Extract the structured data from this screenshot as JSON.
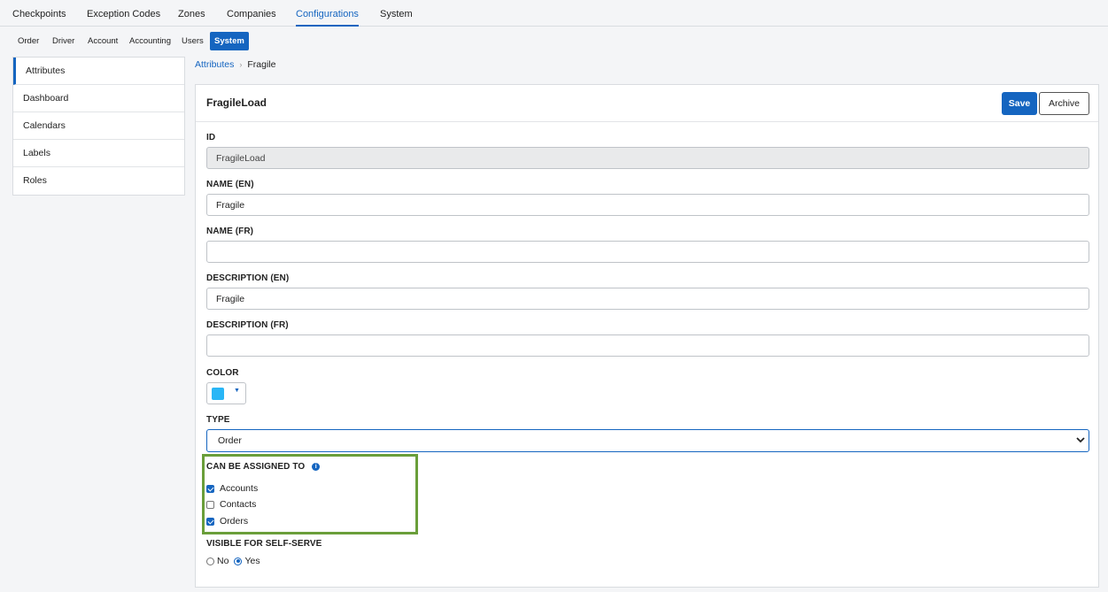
{
  "topnav": {
    "tabs": [
      {
        "label": "Checkpoints"
      },
      {
        "label": "Exception Codes"
      },
      {
        "label": "Zones"
      },
      {
        "label": "Companies"
      },
      {
        "label": "Configurations",
        "active": true
      },
      {
        "label": "System"
      }
    ]
  },
  "subnav": {
    "tabs": [
      {
        "label": "Order"
      },
      {
        "label": "Driver"
      },
      {
        "label": "Account"
      },
      {
        "label": "Accounting"
      },
      {
        "label": "Users"
      },
      {
        "label": "System",
        "active": true
      }
    ]
  },
  "sidebar": {
    "items": [
      {
        "label": "Attributes",
        "active": true
      },
      {
        "label": "Dashboard"
      },
      {
        "label": "Calendars"
      },
      {
        "label": "Labels"
      },
      {
        "label": "Roles"
      }
    ]
  },
  "breadcrumb": {
    "parent": "Attributes",
    "separator": "›",
    "current": "Fragile"
  },
  "panel": {
    "title": "FragileLoad",
    "save_label": "Save",
    "archive_label": "Archive"
  },
  "form": {
    "id": {
      "label": "ID",
      "value": "FragileLoad"
    },
    "name_en": {
      "label": "NAME (EN)",
      "value": "Fragile"
    },
    "name_fr": {
      "label": "NAME (FR)",
      "value": ""
    },
    "description_en": {
      "label": "DESCRIPTION (EN)",
      "value": "Fragile"
    },
    "description_fr": {
      "label": "DESCRIPTION (FR)",
      "value": ""
    },
    "color": {
      "label": "COLOR",
      "value": "#29b6f6"
    },
    "type": {
      "label": "TYPE",
      "value": "Order"
    },
    "assignable": {
      "label": "CAN BE ASSIGNED TO",
      "info_icon": "info-icon",
      "options": [
        {
          "label": "Accounts",
          "checked": true
        },
        {
          "label": "Contacts",
          "checked": false
        },
        {
          "label": "Orders",
          "checked": true
        }
      ]
    },
    "self_serve": {
      "label": "VISIBLE FOR SELF-SERVE",
      "options": [
        {
          "label": "No",
          "selected": false
        },
        {
          "label": "Yes",
          "selected": true
        }
      ]
    }
  },
  "colors": {
    "accent": "#1565c0",
    "highlight_border": "#6a9e3a"
  }
}
